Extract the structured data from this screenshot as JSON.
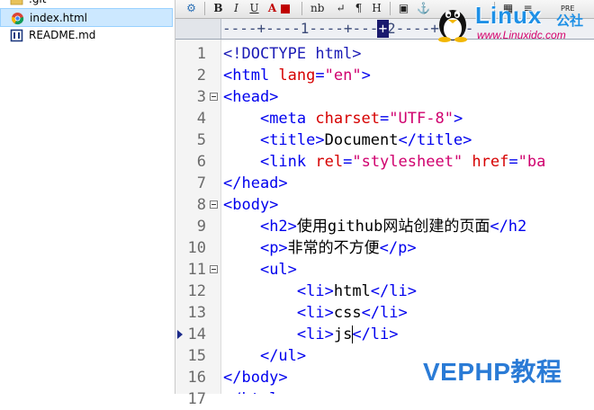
{
  "sidebar": {
    "items": [
      {
        "label": ".git",
        "icon": "folder-icon",
        "selected": false
      },
      {
        "label": "index.html",
        "icon": "chrome-icon",
        "selected": true
      },
      {
        "label": "README.md",
        "icon": "markdown-file-icon",
        "selected": false
      }
    ]
  },
  "toolbar": {
    "buttons": [
      {
        "name": "globe-icon",
        "label": "⚙"
      },
      {
        "name": "bold-button",
        "label": "B"
      },
      {
        "name": "italic-button",
        "label": "I"
      },
      {
        "name": "underline-button",
        "label": "U"
      },
      {
        "name": "font-color-button",
        "label": "A"
      },
      {
        "name": "color-swatch-icon",
        "label": ""
      },
      {
        "name": "nbsp-button",
        "label": "nb"
      },
      {
        "name": "line-break-button",
        "label": "↵"
      },
      {
        "name": "paragraph-button",
        "label": "¶"
      },
      {
        "name": "heading-button",
        "label": "H"
      },
      {
        "name": "image-button",
        "label": "▣"
      },
      {
        "name": "anchor-button",
        "label": "⚓"
      },
      {
        "name": "table-button",
        "label": "▦"
      },
      {
        "name": "list-button",
        "label": "≡"
      },
      {
        "name": "pre-button",
        "label": "PRE"
      }
    ]
  },
  "ruler": {
    "scale": "----+----1----+----2----+----",
    "cursor_glyph": "+"
  },
  "editor": {
    "caret_line": 14,
    "fold_lines": [
      3,
      8,
      11
    ],
    "lines": [
      {
        "n": "1",
        "indent": "",
        "tokens": [
          {
            "c": "t-doc",
            "t": "<!DOCTYPE html>"
          }
        ]
      },
      {
        "n": "2",
        "indent": "",
        "tokens": [
          {
            "c": "t-tag",
            "t": "<html "
          },
          {
            "c": "t-attr",
            "t": "lang"
          },
          {
            "c": "t-tag",
            "t": "="
          },
          {
            "c": "t-val",
            "t": "\"en\""
          },
          {
            "c": "t-tag",
            "t": ">"
          }
        ]
      },
      {
        "n": "3",
        "indent": "",
        "tokens": [
          {
            "c": "t-tag",
            "t": "<head>"
          }
        ]
      },
      {
        "n": "4",
        "indent": "    ",
        "tokens": [
          {
            "c": "t-tag",
            "t": "<meta "
          },
          {
            "c": "t-attr",
            "t": "charset"
          },
          {
            "c": "t-tag",
            "t": "="
          },
          {
            "c": "t-val",
            "t": "\"UTF-8\""
          },
          {
            "c": "t-tag",
            "t": ">"
          }
        ]
      },
      {
        "n": "5",
        "indent": "    ",
        "tokens": [
          {
            "c": "t-tag",
            "t": "<title>"
          },
          {
            "c": "t-text",
            "t": "Document"
          },
          {
            "c": "t-tag",
            "t": "</title>"
          }
        ]
      },
      {
        "n": "6",
        "indent": "    ",
        "tokens": [
          {
            "c": "t-tag",
            "t": "<link "
          },
          {
            "c": "t-attr",
            "t": "rel"
          },
          {
            "c": "t-tag",
            "t": "="
          },
          {
            "c": "t-val",
            "t": "\"stylesheet\""
          },
          {
            "c": "t-tag",
            "t": " "
          },
          {
            "c": "t-attr",
            "t": "href"
          },
          {
            "c": "t-tag",
            "t": "="
          },
          {
            "c": "t-val",
            "t": "\"ba"
          }
        ]
      },
      {
        "n": "7",
        "indent": "",
        "tokens": [
          {
            "c": "t-tag",
            "t": "</head>"
          }
        ]
      },
      {
        "n": "8",
        "indent": "",
        "tokens": [
          {
            "c": "t-tag",
            "t": "<body>"
          }
        ]
      },
      {
        "n": "9",
        "indent": "    ",
        "tokens": [
          {
            "c": "t-tag",
            "t": "<h2>"
          },
          {
            "c": "t-text",
            "t": "使用github网站创建的页面"
          },
          {
            "c": "t-tag",
            "t": "</h2"
          }
        ]
      },
      {
        "n": "10",
        "indent": "    ",
        "tokens": [
          {
            "c": "t-tag",
            "t": "<p>"
          },
          {
            "c": "t-text",
            "t": "非常的不方便"
          },
          {
            "c": "t-tag",
            "t": "</p>"
          }
        ]
      },
      {
        "n": "11",
        "indent": "    ",
        "tokens": [
          {
            "c": "t-tag",
            "t": "<ul>"
          }
        ]
      },
      {
        "n": "12",
        "indent": "        ",
        "tokens": [
          {
            "c": "t-tag",
            "t": "<li>"
          },
          {
            "c": "t-text",
            "t": "html"
          },
          {
            "c": "t-tag",
            "t": "</li>"
          }
        ]
      },
      {
        "n": "13",
        "indent": "        ",
        "tokens": [
          {
            "c": "t-tag",
            "t": "<li>"
          },
          {
            "c": "t-text",
            "t": "css"
          },
          {
            "c": "t-tag",
            "t": "</li>"
          }
        ]
      },
      {
        "n": "14",
        "indent": "        ",
        "tokens": [
          {
            "c": "t-tag",
            "t": "<li>"
          },
          {
            "c": "t-text",
            "t": "js"
          },
          {
            "c": "t-tag",
            "t": "</li>"
          }
        ]
      },
      {
        "n": "15",
        "indent": "    ",
        "tokens": [
          {
            "c": "t-tag",
            "t": "</ul>"
          }
        ]
      },
      {
        "n": "16",
        "indent": "",
        "tokens": [
          {
            "c": "t-tag",
            "t": "</body>"
          }
        ]
      },
      {
        "n": "17",
        "indent": "",
        "tokens": [
          {
            "c": "t-tag",
            "t": "</html>"
          }
        ]
      }
    ]
  },
  "watermarks": {
    "linux_title": "Linux",
    "linux_cn": "公社",
    "linux_url": "www.Linuxidc.com",
    "vephp": "VEPHP教程"
  },
  "colors": {
    "tag": "#0000ee",
    "attr": "#d60000",
    "value": "#d0006e",
    "selection": "#cce8ff",
    "watermark_blue": "#1e90e6"
  }
}
